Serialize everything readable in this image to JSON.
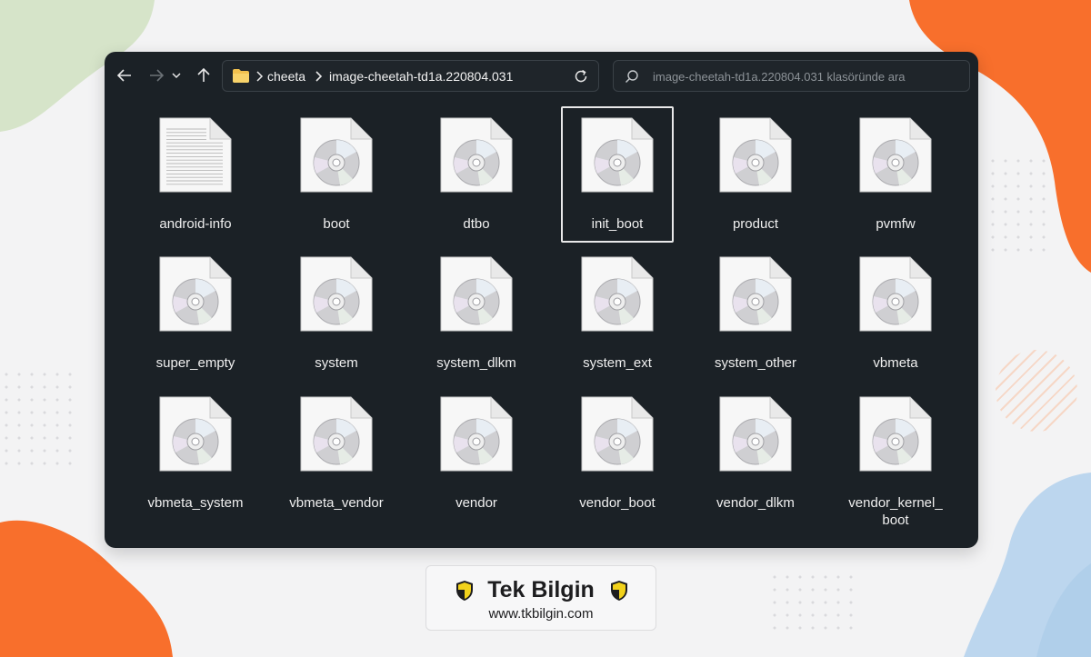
{
  "address_bar": {
    "breadcrumb": [
      {
        "label": "cheeta"
      },
      {
        "label": "image-cheetah-td1a.220804.031"
      }
    ]
  },
  "search": {
    "placeholder": "image-cheetah-td1a.220804.031 klasöründe ara"
  },
  "files": [
    {
      "name": "android-info",
      "type": "text-file-icon",
      "selected": false
    },
    {
      "name": "boot",
      "type": "disc-image-icon",
      "selected": false
    },
    {
      "name": "dtbo",
      "type": "disc-image-icon",
      "selected": false
    },
    {
      "name": "init_boot",
      "type": "disc-image-icon",
      "selected": true
    },
    {
      "name": "product",
      "type": "disc-image-icon",
      "selected": false
    },
    {
      "name": "pvmfw",
      "type": "disc-image-icon",
      "selected": false
    },
    {
      "name": "super_empty",
      "type": "disc-image-icon",
      "selected": false
    },
    {
      "name": "system",
      "type": "disc-image-icon",
      "selected": false
    },
    {
      "name": "system_dlkm",
      "type": "disc-image-icon",
      "selected": false
    },
    {
      "name": "system_ext",
      "type": "disc-image-icon",
      "selected": false
    },
    {
      "name": "system_other",
      "type": "disc-image-icon",
      "selected": false
    },
    {
      "name": "vbmeta",
      "type": "disc-image-icon",
      "selected": false
    },
    {
      "name": "vbmeta_system",
      "type": "disc-image-icon",
      "selected": false
    },
    {
      "name": "vbmeta_vendor",
      "type": "disc-image-icon",
      "selected": false
    },
    {
      "name": "vendor",
      "type": "disc-image-icon",
      "selected": false
    },
    {
      "name": "vendor_boot",
      "type": "disc-image-icon",
      "selected": false
    },
    {
      "name": "vendor_dlkm",
      "type": "disc-image-icon",
      "selected": false
    },
    {
      "name": "vendor_kernel_\nboot",
      "type": "disc-image-icon",
      "selected": false
    }
  ],
  "brand": {
    "title": "Tek Bilgin",
    "url": "www.tkbilgin.com"
  },
  "colors": {
    "window_bg": "#1b2126",
    "accent_orange": "#f86f2c",
    "accent_blue": "#bcd6ee",
    "accent_green": "#d6e4c9"
  }
}
